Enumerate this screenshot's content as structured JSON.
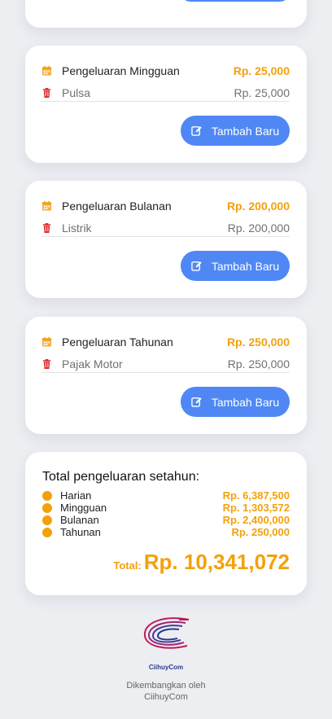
{
  "cards": [
    {
      "header_label": "Pengeluaran Mingguan",
      "header_amount": "Rp. 25,000",
      "item_label": "Pulsa",
      "item_amount": "Rp. 25,000",
      "button_label": "Tambah Baru"
    },
    {
      "header_label": "Pengeluaran Bulanan",
      "header_amount": "Rp. 200,000",
      "item_label": "Listrik",
      "item_amount": "Rp. 200,000",
      "button_label": "Tambah Baru"
    },
    {
      "header_label": "Pengeluaran Tahunan",
      "header_amount": "Rp. 250,000",
      "item_label": "Pajak Motor",
      "item_amount": "Rp. 250,000",
      "button_label": "Tambah Baru"
    }
  ],
  "summary": {
    "title": "Total pengeluaran setahun:",
    "rows": [
      {
        "label": "Harian",
        "amount": "Rp. 6,387,500"
      },
      {
        "label": "Mingguan",
        "amount": "Rp. 1,303,572"
      },
      {
        "label": "Bulanan",
        "amount": "Rp. 2,400,000"
      },
      {
        "label": "Tahunan",
        "amount": "Rp. 250,000"
      }
    ],
    "total_label": "Total:",
    "total_value": "Rp. 10,341,072"
  },
  "footer": {
    "logo_text": "CiihuyCom",
    "developed_by": "Dikembangkan oleh",
    "developer": "CiihuyCom"
  },
  "icons": {
    "header": "calendar-icon",
    "item": "trash-icon",
    "button": "edit-icon"
  },
  "colors": {
    "accent": "#f3a10b",
    "button": "#4f88f5",
    "delete": "#e02828",
    "background": "#eceef2"
  }
}
